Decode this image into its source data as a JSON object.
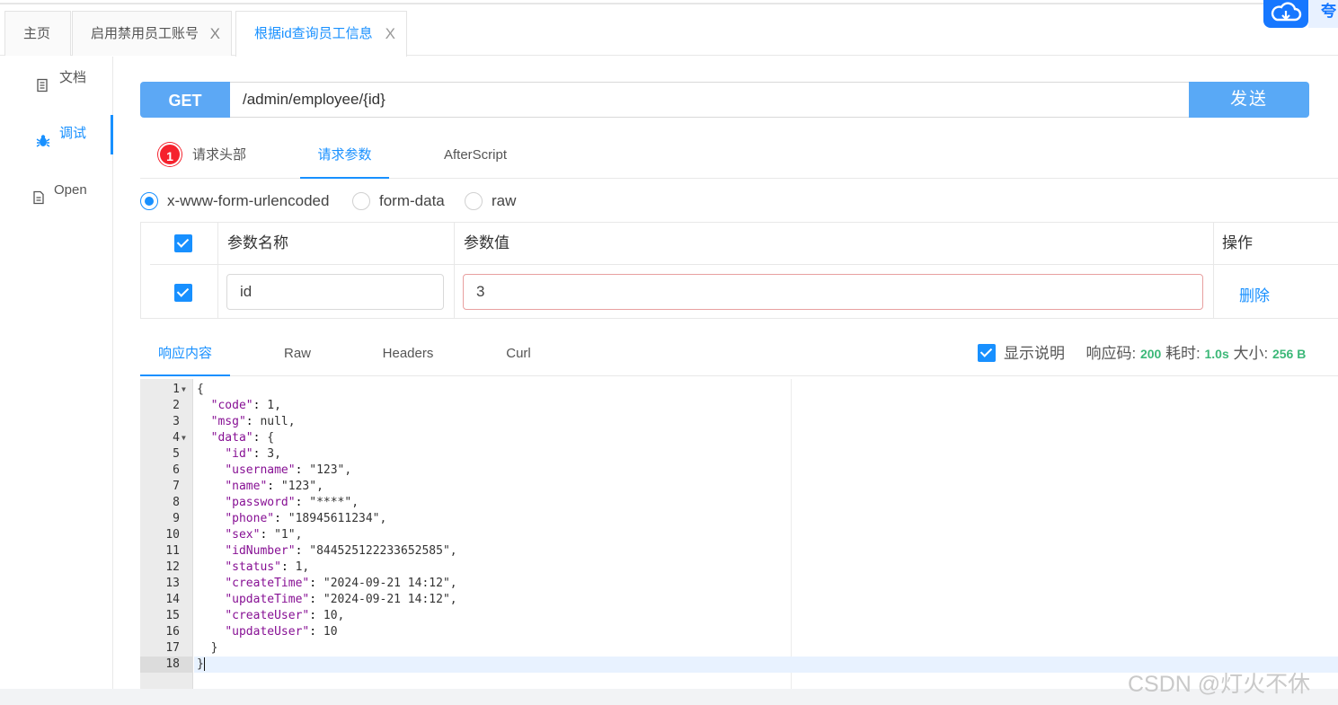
{
  "tabs": [
    {
      "label": "主页",
      "closable": false
    },
    {
      "label": "启用禁用员工账号",
      "closable": true
    },
    {
      "label": "根据id查询员工信息",
      "closable": true,
      "active": true
    }
  ],
  "tab_close_glyph": "X",
  "corner_badge_text": "夸",
  "sidebar": {
    "items": [
      {
        "label": "文档",
        "icon": "document-icon"
      },
      {
        "label": "调试",
        "icon": "bug-icon",
        "active": true
      },
      {
        "label": "Open",
        "icon": "file-icon"
      }
    ]
  },
  "request": {
    "method": "GET",
    "url": "/admin/employee/{id}",
    "send_label": "发送"
  },
  "request_tabs": {
    "headers_label": "请求头部",
    "headers_badge": "1",
    "params_label": "请求参数",
    "afterscript_label": "AfterScript",
    "active": "请求参数"
  },
  "body_types": [
    {
      "label": "x-www-form-urlencoded",
      "checked": true
    },
    {
      "label": "form-data",
      "checked": false
    },
    {
      "label": "raw",
      "checked": false
    }
  ],
  "params_table": {
    "headers": {
      "name": "参数名称",
      "value": "参数值",
      "action": "操作"
    },
    "rows": [
      {
        "checked": true,
        "name": "id",
        "value": "3",
        "action": "删除"
      }
    ]
  },
  "response_tabs": [
    "响应内容",
    "Raw",
    "Headers",
    "Curl"
  ],
  "response_info": {
    "show_desc_label": "显示说明",
    "show_desc_checked": true,
    "code_label": "响应码:",
    "code": "200",
    "time_label": "耗时:",
    "time": "1.0s",
    "size_label": "大小:",
    "size": "256 B"
  },
  "response_json": {
    "lines": [
      {
        "t": "{"
      },
      {
        "t": "  \"code\": 1,"
      },
      {
        "t": "  \"msg\": null,"
      },
      {
        "t": "  \"data\": {"
      },
      {
        "t": "    \"id\": 3,"
      },
      {
        "t": "    \"username\": \"123\","
      },
      {
        "t": "    \"name\": \"123\","
      },
      {
        "t": "    \"password\": \"****\","
      },
      {
        "t": "    \"phone\": \"18945611234\","
      },
      {
        "t": "    \"sex\": \"1\","
      },
      {
        "t": "    \"idNumber\": \"844525122233652585\","
      },
      {
        "t": "    \"status\": 1,"
      },
      {
        "t": "    \"createTime\": \"2024-09-21 14:12\","
      },
      {
        "t": "    \"updateTime\": \"2024-09-21 14:12\","
      },
      {
        "t": "    \"createUser\": 10,"
      },
      {
        "t": "    \"updateUser\": 10"
      },
      {
        "t": "  }"
      },
      {
        "t": "}"
      }
    ],
    "folds": [
      1,
      4
    ],
    "current_line": 18
  },
  "watermark": "CSDN @灯火不休"
}
